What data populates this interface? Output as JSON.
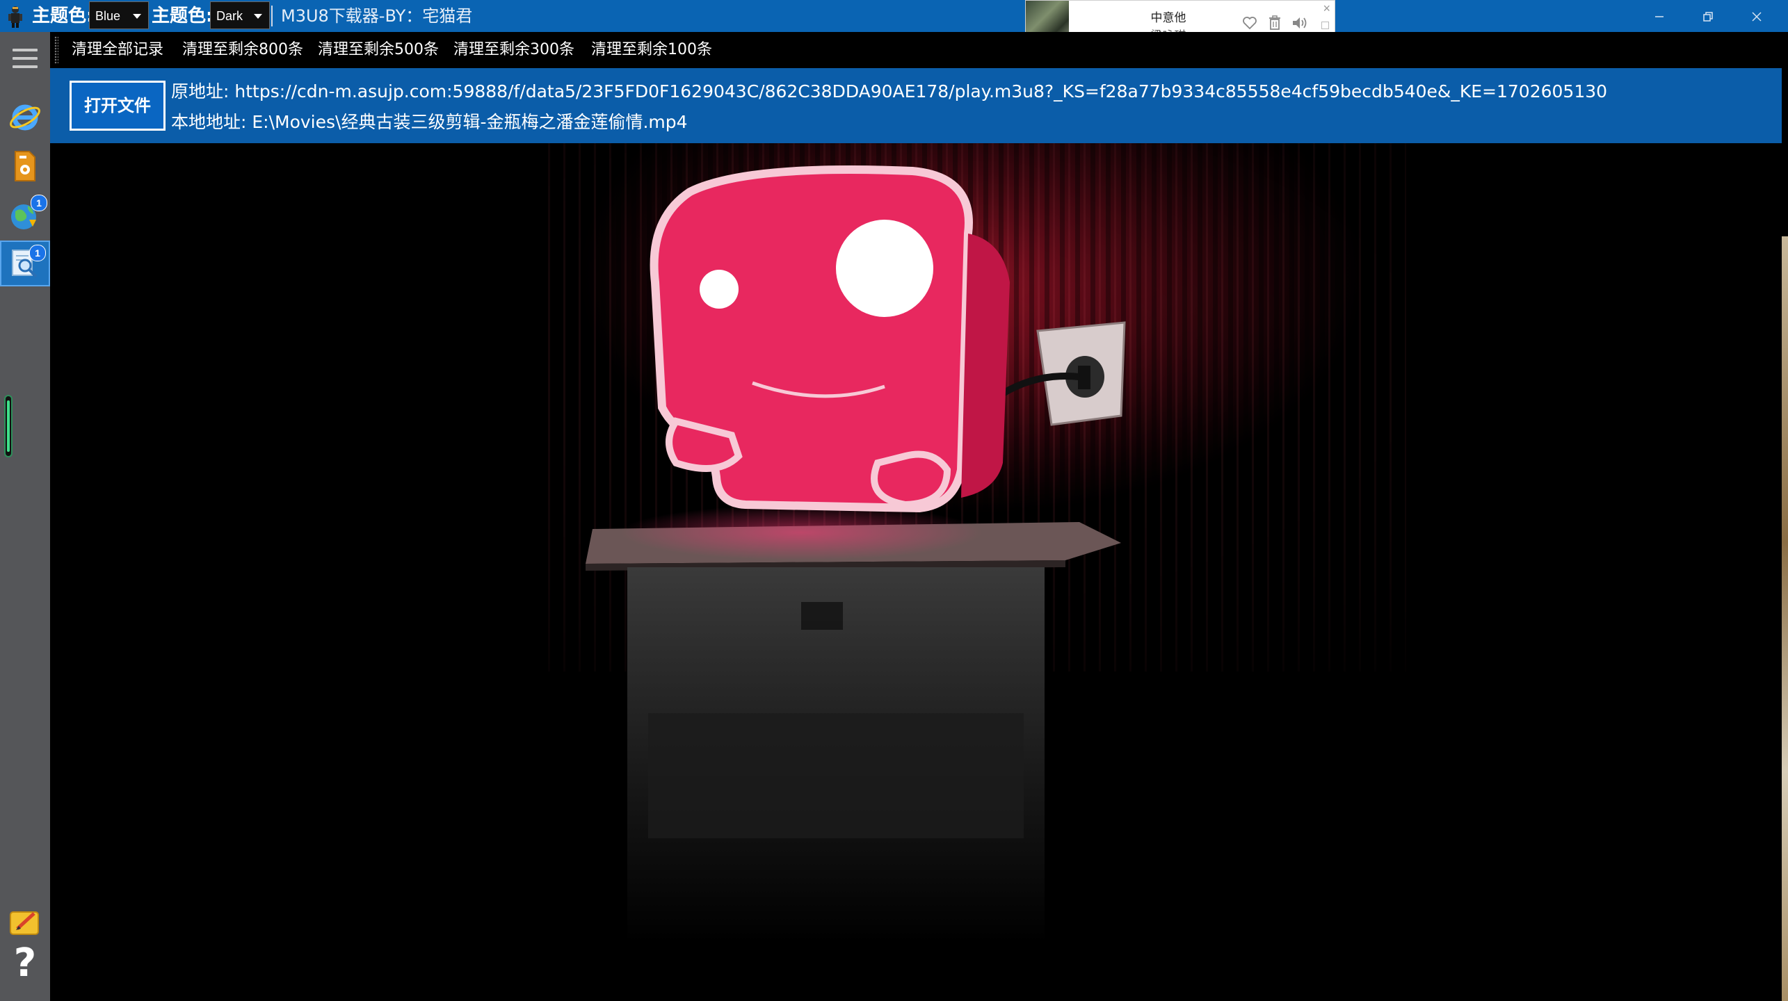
{
  "titlebar": {
    "theme1_label": "主题色:",
    "theme1_value": "Blue",
    "theme2_label": "主题色:",
    "theme2_value": "Dark",
    "app_title": "M3U8下载器-BY：宅猫君",
    "accent_color": "#0a64b3"
  },
  "music_widget": {
    "song_title": "中意他",
    "artist": "梁咏琪"
  },
  "sidebar": {
    "items": [
      {
        "icon": "ie-browser-icon",
        "badge": ""
      },
      {
        "icon": "audio-file-icon",
        "badge": ""
      },
      {
        "icon": "globe-download-icon",
        "badge": "1"
      },
      {
        "icon": "search-doc-icon",
        "badge": "1"
      }
    ],
    "help_icon": "?"
  },
  "clearbar": {
    "buttons": [
      "清理全部记录",
      "清理至剩余800条",
      "清理至剩余500条",
      "清理至剩余300条",
      "清理至剩余100条"
    ]
  },
  "info_panel": {
    "open_button": "打开文件",
    "source_label": "原地址: ",
    "source_url": "https://cdn-m.asujp.com:59888/f/data5/23F5FD0F1629043C/862C38DDA90AE178/play.m3u8?_KS=f28a77b9334c85558e4cf59becdb540e&_KE=1702605130",
    "local_label": "本地地址: ",
    "local_path": "E:\\Movies\\经典古装三级剪辑-金瓶梅之潘金莲偷情.mp4"
  }
}
